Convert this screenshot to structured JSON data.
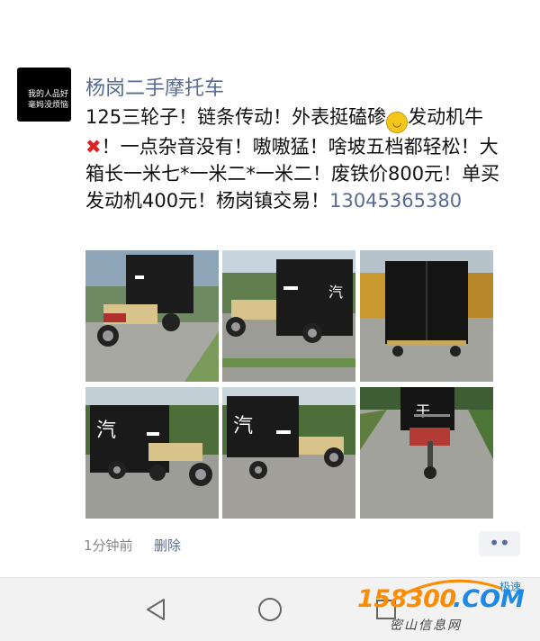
{
  "post": {
    "avatar_text_line1": "我的人品好",
    "avatar_text_line2": "毫妈没烦恼",
    "author": "杨岗二手摩托车",
    "text_part1": "125三轮子！链条传动！外表挺磕碜",
    "emoji_icon": "grinning-face-icon",
    "text_part2": "发动机牛",
    "cross_icon": "red-cross-icon",
    "text_part3": "！一点杂音没有！嗷嗷猛！啥坡五档都轻松！大箱长一米七*一米二*一米二！废铁价800元！单买发动机400元！杨岗镇交易！",
    "phone": "13045365380",
    "photos": [
      "photo-1",
      "photo-2",
      "photo-3",
      "photo-4",
      "photo-5",
      "photo-6"
    ],
    "time": "1分钟前",
    "delete_label": "删除",
    "more_label": "••"
  },
  "navbar": {
    "back_icon": "back-triangle-icon",
    "home_icon": "home-circle-icon",
    "recent_icon": "recent-square-icon"
  },
  "watermark": {
    "number": "158300",
    "domain": ".COM",
    "tag": "极速",
    "subtitle": "密山信息网"
  },
  "colors": {
    "link": "#576b95",
    "watermark_orange": "#ff8c00",
    "watermark_blue": "#1e88e5"
  }
}
